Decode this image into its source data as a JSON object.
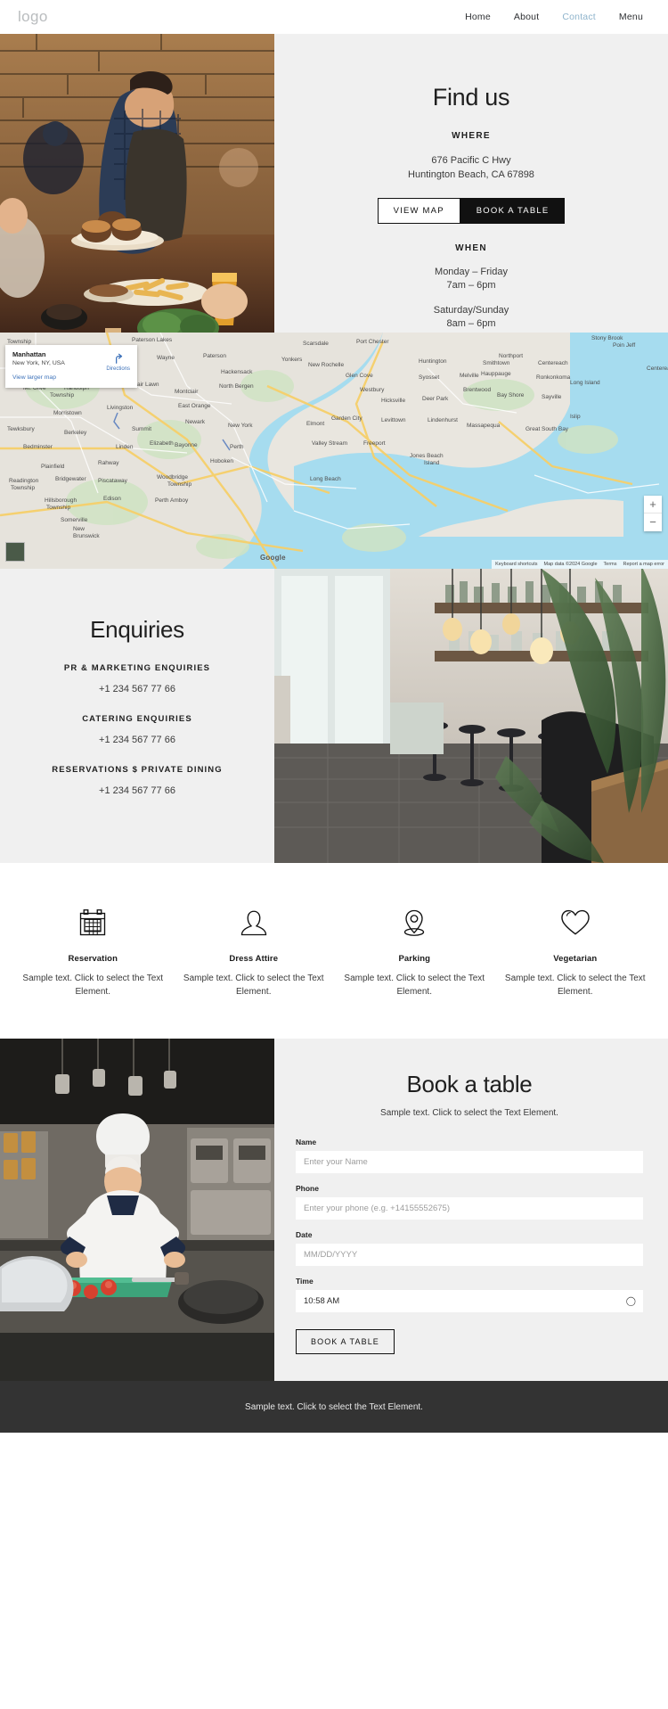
{
  "header": {
    "logo": "logo",
    "nav": [
      {
        "label": "Home",
        "active": false
      },
      {
        "label": "About",
        "active": false
      },
      {
        "label": "Contact",
        "active": true
      },
      {
        "label": "Menu",
        "active": false
      }
    ]
  },
  "find_us": {
    "title": "Find us",
    "where_label": "WHERE",
    "address_line1": "676 Pacific C Hwy",
    "address_line2": "Huntington Beach, CA 67898",
    "view_map_button": "VIEW MAP",
    "book_table_button": "BOOK A TABLE",
    "when_label": "WHEN",
    "weekday_days": "Monday – Friday",
    "weekday_hours": "7am – 6pm",
    "weekend_days": "Saturday/Sunday",
    "weekend_hours": "8am – 6pm"
  },
  "map": {
    "place_title": "Manhattan",
    "place_sub": "New York, NY, USA",
    "directions_label": "Directions",
    "view_larger": "View larger map",
    "zoom_in": "+",
    "zoom_out": "−",
    "logo_text": "Google",
    "attribution": [
      "Keyboard shortcuts",
      "Map data ©2024 Google",
      "Terms",
      "Report a map error"
    ]
  },
  "enquiries": {
    "title": "Enquiries",
    "items": [
      {
        "heading": "PR & MARKETING ENQUIRIES",
        "phone": "+1 234 567 77 66"
      },
      {
        "heading": "CATERING ENQUIRIES",
        "phone": "+1 234 567 77 66"
      },
      {
        "heading": "RESERVATIONS $ PRIVATE DINING",
        "phone": "+1 234 567 77 66"
      }
    ]
  },
  "features": [
    {
      "icon": "calendar-icon",
      "title": "Reservation",
      "text": "Sample text. Click to select the Text Element."
    },
    {
      "icon": "person-icon",
      "title": "Dress Attire",
      "text": "Sample text. Click to select the Text Element."
    },
    {
      "icon": "map-pin-icon",
      "title": "Parking",
      "text": "Sample text. Click to select the Text Element."
    },
    {
      "icon": "heart-icon",
      "title": "Vegetarian",
      "text": "Sample text. Click to select the Text Element."
    }
  ],
  "booking": {
    "title": "Book a table",
    "subtitle": "Sample text. Click to select the Text Element.",
    "name_label": "Name",
    "name_placeholder": "Enter your Name",
    "phone_label": "Phone",
    "phone_placeholder": "Enter your phone (e.g. +14155552675)",
    "date_label": "Date",
    "date_placeholder": "MM/DD/YYYY",
    "time_label": "Time",
    "time_value": "10:58 AM",
    "submit_button": "BOOK A TABLE"
  },
  "footer": {
    "text": "Sample text. Click to select the Text Element."
  },
  "colors": {
    "panel_bg": "#f0f0f0",
    "accent_link": "#8fb4cc",
    "footer_bg": "#333333",
    "dark": "#111111"
  }
}
